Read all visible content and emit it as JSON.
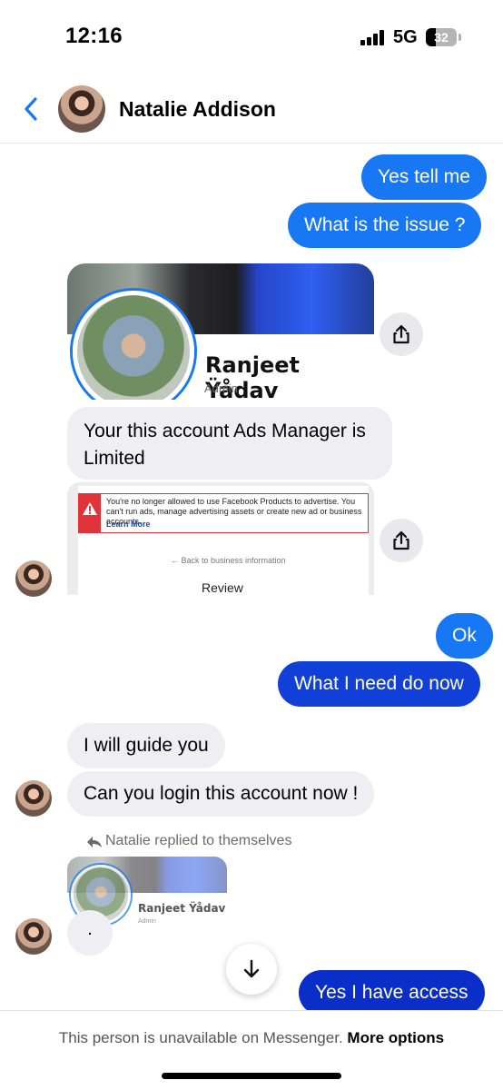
{
  "status_bar": {
    "time": "12:16",
    "network": "5G",
    "battery": "32",
    "battery_level": 0.32
  },
  "header": {
    "contact_name": "Natalie Addison",
    "back_icon": "chevron-left-icon"
  },
  "messages": {
    "m1": "Yes tell me",
    "m2": "What is the issue ?",
    "m3": "Your this account Ads Manager is Limited",
    "m4": "Ok",
    "m5": "What I need do now",
    "m6": "I will guide you",
    "m7": "Can you login this account now !",
    "m8": ".",
    "m9": "Yes I have access"
  },
  "profile_card": {
    "name": "Ranjeet Ÿådav",
    "role": "Admin"
  },
  "restriction_shot": {
    "alert_text": "You're no longer allowed to use Facebook Products to advertise. You can't run ads, manage advertising assets or create new ad or business accounts.",
    "learn_more": "Learn More",
    "back_link": "← Back to business information",
    "review": "Review"
  },
  "reply_note": "Natalie replied to themselves",
  "mini_card": {
    "name": "Ranjeet Ÿådav",
    "role": "Admin"
  },
  "footer": {
    "text": "This person is unavailable on Messenger.",
    "action": "More options"
  },
  "colors": {
    "outgoing": "#1877f2",
    "incoming": "#efeff3",
    "accent": "#1877f2"
  }
}
